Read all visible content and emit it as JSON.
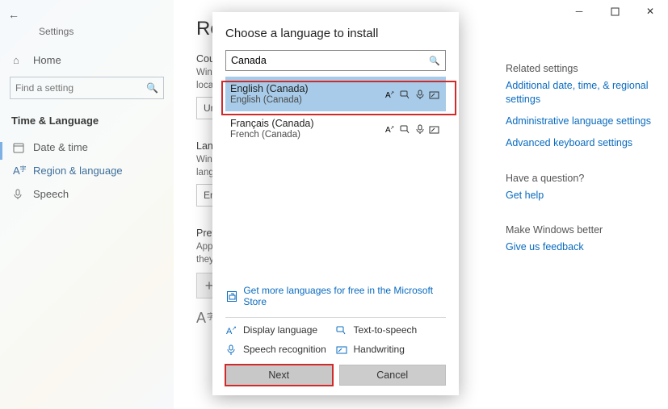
{
  "window": {
    "app_title": "Settings"
  },
  "sidebar": {
    "home": "Home",
    "search_placeholder": "Find a setting",
    "header": "Time & Language",
    "items": [
      {
        "label": "Date & time"
      },
      {
        "label": "Region & language"
      },
      {
        "label": "Speech"
      }
    ]
  },
  "mid": {
    "title_partial": "Reg",
    "country_hdr_partial": "Cour",
    "country_desc1": "Windo",
    "country_desc2": "local c",
    "country_value": "Unit",
    "lang_hdr": "Lang",
    "lang_desc1": "Windo",
    "lang_desc2": "langua",
    "lang_value": "Engl",
    "pref_hdr": "Prefer",
    "pref_desc1": "Apps",
    "pref_desc2": "they s"
  },
  "right": {
    "hd1": "Related settings",
    "l1": "Additional date, time, & regional settings",
    "l2": "Administrative language settings",
    "l3": "Advanced keyboard settings",
    "hd2": "Have a question?",
    "l4": "Get help",
    "hd3": "Make Windows better",
    "l5": "Give us feedback"
  },
  "dialog": {
    "title": "Choose a language to install",
    "search_value": "Canada",
    "results": [
      {
        "native": "English (Canada)",
        "english": "English (Canada)"
      },
      {
        "native": "Français (Canada)",
        "english": "French (Canada)"
      }
    ],
    "store_link": "Get more languages for free in the Microsoft Store",
    "legend": {
      "display": "Display language",
      "tts": "Text-to-speech",
      "speech": "Speech recognition",
      "hand": "Handwriting"
    },
    "next": "Next",
    "cancel": "Cancel"
  }
}
